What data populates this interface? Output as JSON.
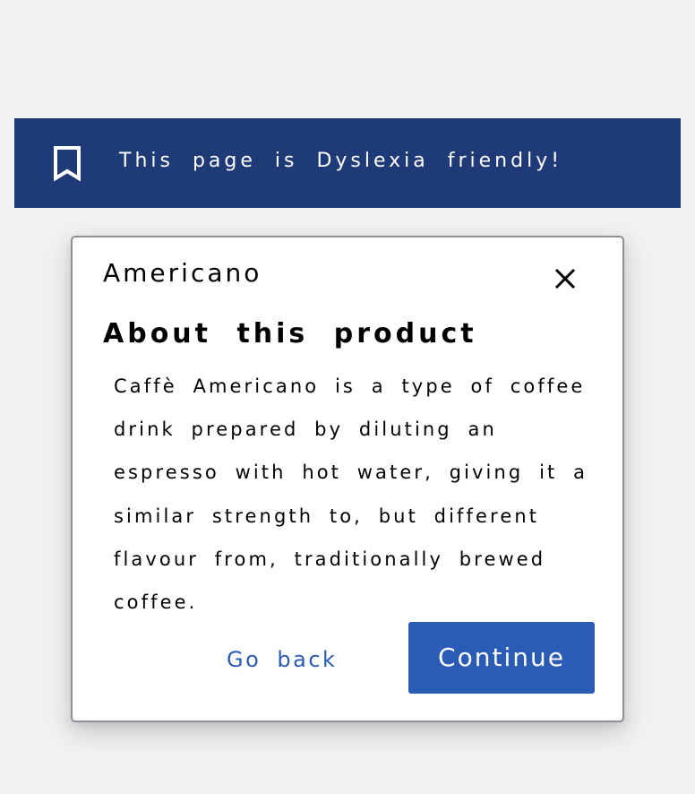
{
  "banner": {
    "icon": "bookmark-icon",
    "text": "This page is Dyslexia friendly!",
    "background_color": "#1f3b77"
  },
  "dialog": {
    "product_name": "Americano",
    "close_icon": "close-icon",
    "heading": "About this product",
    "description": "Caffè Americano is a type of coffee drink prepared by diluting an espresso with hot water, giving it a similar strength to, but different flavour from, traditionally brewed coffee.",
    "buttons": {
      "go_back_label": "Go back",
      "continue_label": "Continue"
    },
    "accent_color": "#2a5cb5"
  }
}
